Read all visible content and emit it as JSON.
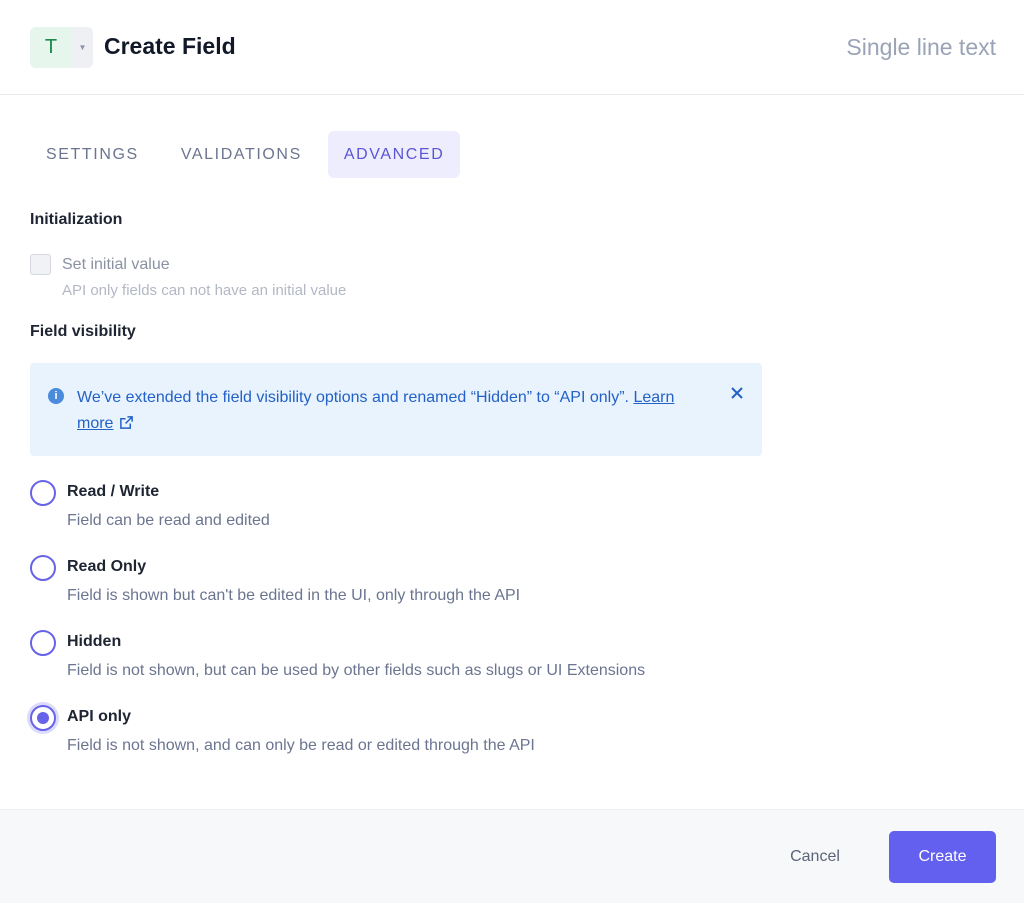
{
  "header": {
    "type_letter": "T",
    "title": "Create Field",
    "field_type": "Single line text"
  },
  "tabs": [
    {
      "label": "SETTINGS",
      "active": false
    },
    {
      "label": "VALIDATIONS",
      "active": false
    },
    {
      "label": "ADVANCED",
      "active": true
    }
  ],
  "initialization": {
    "title": "Initialization",
    "checkbox_label": "Set initial value",
    "checkbox_checked": false,
    "help": "API only fields can not have an initial value"
  },
  "visibility": {
    "title": "Field visibility",
    "notice": {
      "text": "We’ve extended the field visibility options and renamed “Hidden” to “API only”.",
      "link": "Learn more"
    },
    "options": [
      {
        "label": "Read / Write",
        "help": "Field can be read and edited",
        "selected": false
      },
      {
        "label": "Read Only",
        "help": "Field is shown but can't be edited in the UI, only through the API",
        "selected": false
      },
      {
        "label": "Hidden",
        "help": "Field is not shown, but can be used by other fields such as slugs or UI Extensions",
        "selected": false
      },
      {
        "label": "API only",
        "help": "Field is not shown, and can only be read or edited through the API",
        "selected": true
      }
    ]
  },
  "footer": {
    "cancel_label": "Cancel",
    "create_label": "Create"
  },
  "colors": {
    "accent": "#6360f0",
    "info_bg": "#e8f3fd",
    "info_text": "#2361c6"
  }
}
